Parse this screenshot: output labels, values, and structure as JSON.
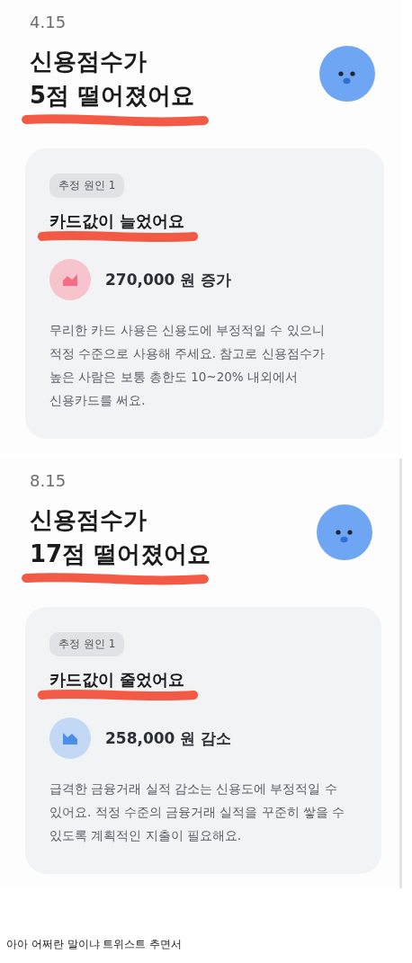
{
  "reports": [
    {
      "date": "4.15",
      "title_lines": [
        "신용점수가",
        "5점 떨어졌어요"
      ],
      "tag": "추정 원인 1",
      "reason": "카드값이 늘었어요",
      "trend": {
        "kind": "up",
        "color": "#f7c3cc"
      },
      "amount": "270,000 원 증가",
      "description_lines": [
        "무리한 카드 사용은 신용도에 부정적일 수 있으니",
        "적정 수준으로 사용해 주세요. 참고로 신용점수가",
        "높은 사람은 보통 총한도 10~20% 내외에서",
        "신용카드를 써요."
      ],
      "side_border": false
    },
    {
      "date": "8.15",
      "title_lines": [
        "신용점수가",
        "17점 떨어졌어요"
      ],
      "tag": "추정 원인 1",
      "reason": "카드값이 줄었어요",
      "trend": {
        "kind": "down",
        "color": "#c3d8f5"
      },
      "amount": "258,000 원 감소",
      "description_lines": [
        "급격한 금융거래 실적 감소는 신용도에 부정적일 수",
        "있어요. 적정 수준의 금융거래 실적을 꾸준히 쌓을 수",
        "있도록 계획적인 지출이 필요해요."
      ],
      "side_border": true
    }
  ],
  "caption": "아아 어쩌란 말이냐 트위스트 추면서"
}
